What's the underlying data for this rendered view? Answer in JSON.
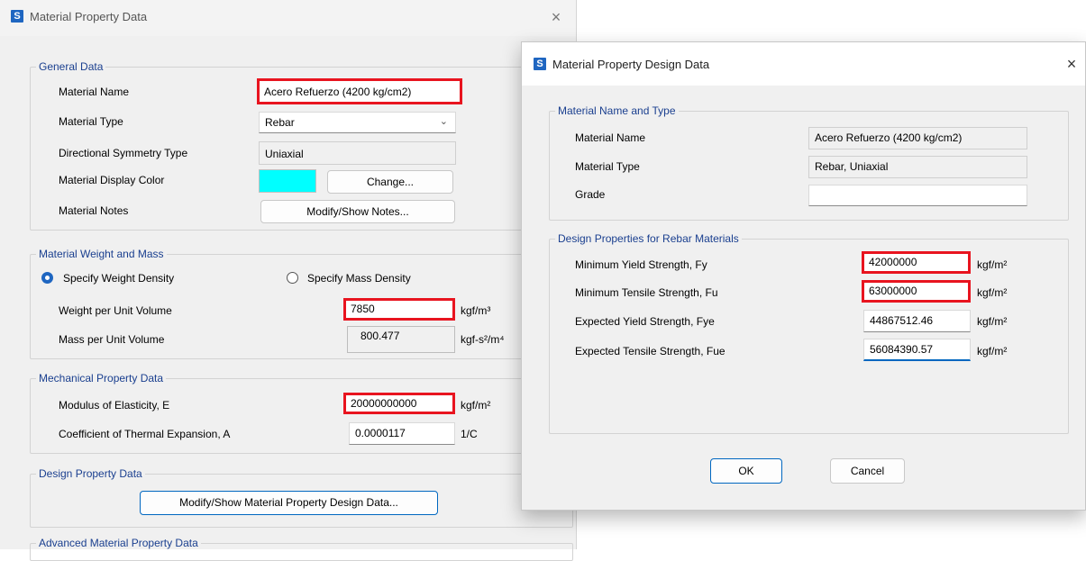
{
  "main_window": {
    "app_icon": "S",
    "title": "Material Property Data",
    "close_icon": "×",
    "general": {
      "title": "General Data",
      "name_label": "Material Name",
      "name_value": "Acero Refuerzo (4200 kg/cm2)",
      "type_label": "Material Type",
      "type_value": "Rebar",
      "symmetry_label": "Directional Symmetry Type",
      "symmetry_value": "Uniaxial",
      "color_label": "Material Display Color",
      "display_color": "#00ffff",
      "change_button": "Change...",
      "notes_label": "Material Notes",
      "notes_button": "Modify/Show Notes..."
    },
    "weight_mass": {
      "title": "Material Weight and Mass",
      "radio_weight": "Specify Weight Density",
      "radio_mass": "Specify Mass Density",
      "selected": "weight",
      "weight_label": "Weight per Unit Volume",
      "weight_value": "7850",
      "weight_unit": "kgf/m³",
      "mass_label": "Mass per Unit Volume",
      "mass_value": "800.477",
      "mass_unit": "kgf-s²/m⁴"
    },
    "mechanical": {
      "title": "Mechanical Property Data",
      "e_label": "Modulus of Elasticity,  E",
      "e_value": "20000000000",
      "e_unit": "kgf/m²",
      "a_label": "Coefficient of Thermal Expansion,  A",
      "a_value": "0.0000117",
      "a_unit": "1/C"
    },
    "design": {
      "title": "Design Property Data",
      "button": "Modify/Show Material Property Design Data..."
    },
    "advanced": {
      "title": "Advanced Material Property Data"
    }
  },
  "design_dialog": {
    "app_icon": "S",
    "title": "Material Property Design Data",
    "close_icon": "×",
    "name_type": {
      "title": "Material Name and Type",
      "name_label": "Material Name",
      "name_value": "Acero Refuerzo (4200 kg/cm2)",
      "type_label": "Material Type",
      "type_value": "Rebar, Uniaxial",
      "grade_label": "Grade",
      "grade_value": ""
    },
    "rebar": {
      "title": "Design Properties for Rebar Materials",
      "fy_label": "Minimum Yield Strength, Fy",
      "fy_value": "42000000",
      "fu_label": "Minimum Tensile Strength, Fu",
      "fu_value": "63000000",
      "fye_label": "Expected Yield Strength, Fye",
      "fye_value": "44867512.46",
      "fue_label": "Expected Tensile Strength, Fue",
      "fue_value": "56084390.57",
      "unit": "kgf/m²"
    },
    "ok_button": "OK",
    "cancel_button": "Cancel"
  },
  "colors": {
    "highlight": "#e8141f",
    "accent": "#1f66c1",
    "group_title": "#1a3f8f"
  }
}
